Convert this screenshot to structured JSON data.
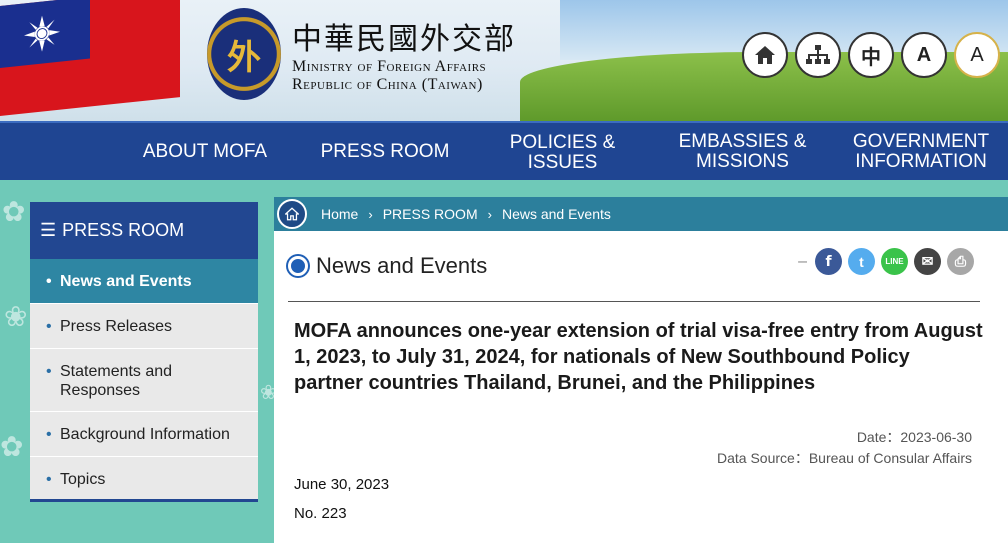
{
  "header": {
    "title_zh": "中華民國外交部",
    "title_en_line1": "Ministry of Foreign Affairs",
    "title_en_line2": "Republic of China (Taiwan)",
    "seal_glyph": "外",
    "tools": [
      {
        "name": "home",
        "label": "⌂"
      },
      {
        "name": "sitemap",
        "label": "⊞"
      },
      {
        "name": "chinese",
        "label": "中"
      },
      {
        "name": "font-small",
        "label": "A"
      },
      {
        "name": "font-large",
        "label": "A"
      }
    ]
  },
  "nav": {
    "items": [
      "ABOUT MOFA",
      "PRESS ROOM",
      "POLICIES & ISSUES",
      "EMBASSIES & MISSIONS",
      "GOVERNMENT INFORMATION"
    ]
  },
  "sidebar": {
    "title": "PRESS ROOM",
    "items": [
      {
        "label": "News and Events",
        "active": true
      },
      {
        "label": "Press Releases",
        "active": false
      },
      {
        "label": "Statements and Responses",
        "active": false
      },
      {
        "label": "Background Information",
        "active": false
      },
      {
        "label": "Topics",
        "active": false
      }
    ]
  },
  "breadcrumb": [
    "Home",
    "PRESS ROOM",
    "News and Events"
  ],
  "page": {
    "title": "News and Events",
    "headline": "MOFA announces one-year extension of trial visa-free entry from August 1, 2023, to July 31, 2024, for nationals of New Southbound Policy partner countries Thailand, Brunei, and the Philippines",
    "date_label": "Date：2023-06-30",
    "source_label": "Data Source：Bureau of Consular Affairs",
    "body_date": "June 30, 2023",
    "body_number": "No. 223"
  },
  "share": {
    "facebook": "f",
    "twitter": "t",
    "line": "LINE",
    "email": "✉",
    "print": "⎙"
  },
  "colors": {
    "nav_bg": "#1f4592",
    "sidebar_active": "#2e86a3",
    "crumb_bg": "#2c7f9c",
    "page_bg": "#6fc9b8"
  }
}
